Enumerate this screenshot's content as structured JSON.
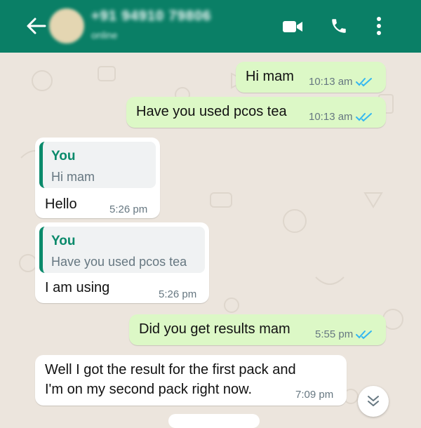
{
  "header": {
    "contact_name": "+91 94910 79806",
    "contact_status": "online",
    "icons": [
      "back-arrow-icon",
      "video-call-icon",
      "voice-call-icon",
      "more-options-icon"
    ]
  },
  "colors": {
    "header_bg": "#0a7f66",
    "chat_bg": "#ece5dd",
    "outgoing_bubble": "#dcf8c6",
    "incoming_bubble": "#ffffff",
    "read_ticks": "#34b7f1"
  },
  "messages": [
    {
      "direction": "out",
      "text": "Hi mam",
      "time": "10:13 am",
      "status": "read"
    },
    {
      "direction": "out",
      "text": "Have you used pcos tea",
      "time": "10:13 am",
      "status": "read"
    },
    {
      "direction": "in",
      "quote": {
        "author": "You",
        "text": "Hi mam"
      },
      "text": "Hello",
      "time": "5:26 pm"
    },
    {
      "direction": "in",
      "quote": {
        "author": "You",
        "text": "Have you used pcos tea"
      },
      "text": "I am using",
      "time": "5:26 pm"
    },
    {
      "direction": "out",
      "text": "Did you get results mam",
      "time": "5:55 pm",
      "status": "read"
    },
    {
      "direction": "in",
      "text_line1": "Well I got the result for the first pack and",
      "text_line2": "I'm on my second pack right now.",
      "time": "7:09 pm"
    }
  ],
  "scroll_button": {
    "icon": "chevron-double-down-icon"
  }
}
